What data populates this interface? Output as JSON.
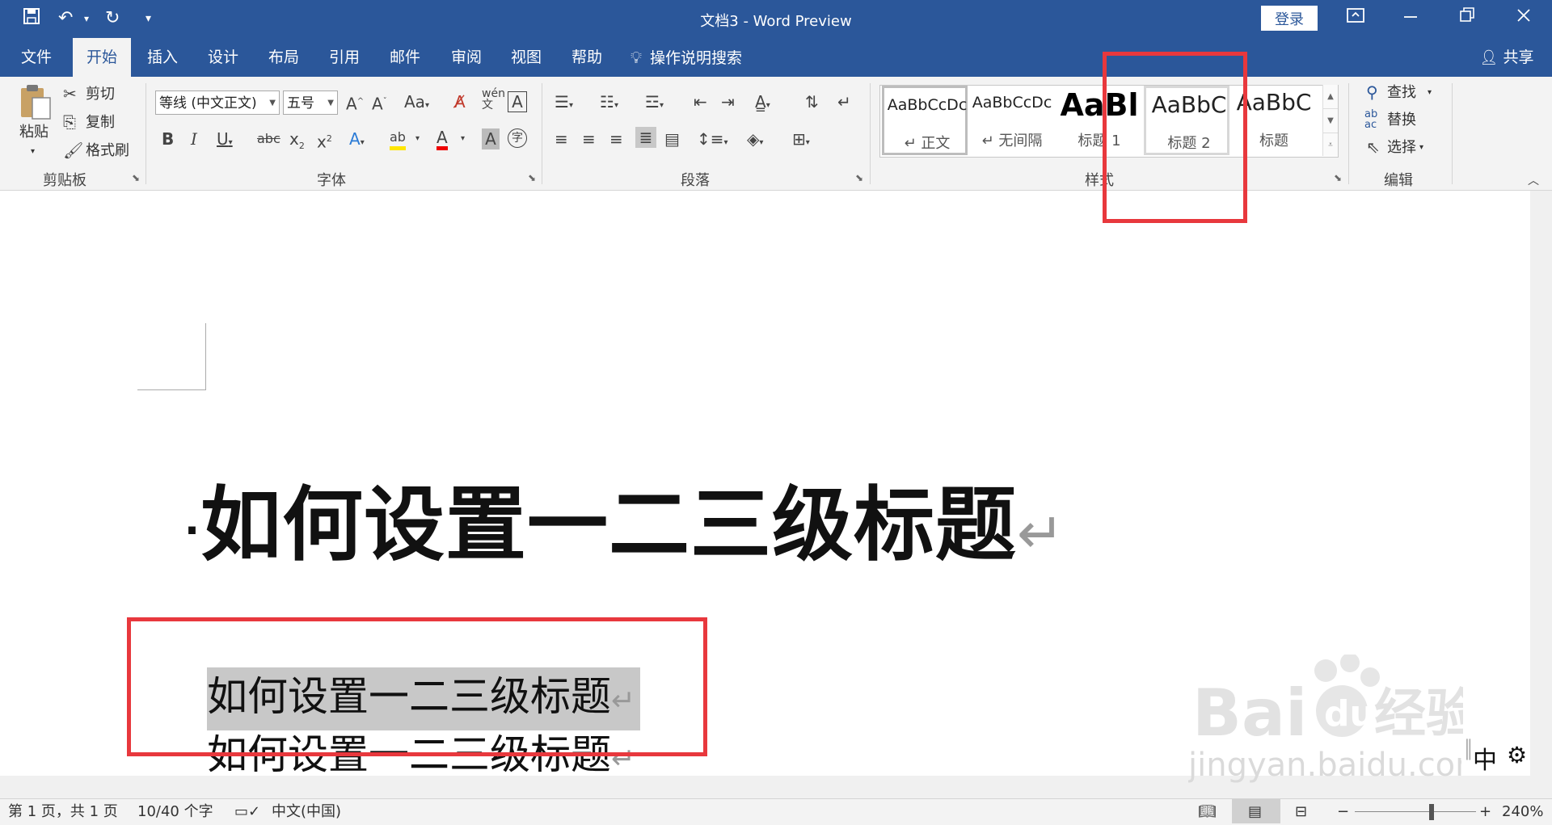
{
  "titlebar": {
    "title": "文档3  -  Word Preview",
    "login": "登录",
    "qat_more": "▾"
  },
  "tabs": [
    "文件",
    "开始",
    "插入",
    "设计",
    "布局",
    "引用",
    "邮件",
    "审阅",
    "视图",
    "帮助"
  ],
  "tell_me": "操作说明搜索",
  "share": "共享",
  "clipboard": {
    "paste": "粘贴",
    "cut": "剪切",
    "copy": "复制",
    "format_painter": "格式刷",
    "label": "剪贴板"
  },
  "font": {
    "family": "等线 (中文正文)",
    "size": "五号",
    "label": "字体"
  },
  "paragraph": {
    "label": "段落"
  },
  "styles": {
    "label": "样式",
    "items": [
      {
        "sample": "AaBbCcDc",
        "name": "↵ 正文"
      },
      {
        "sample": "AaBbCcDc",
        "name": "↵ 无间隔"
      },
      {
        "sample": "AaBl",
        "name": "标题 1"
      },
      {
        "sample": "AaBbC",
        "name": "标题 2"
      },
      {
        "sample": "AaBbC",
        "name": "标题"
      }
    ]
  },
  "editing": {
    "find": "查找",
    "replace": "替换",
    "select": "选择",
    "label": "编辑"
  },
  "document": {
    "heading": "如何设置一二三级标题",
    "line1": "如何设置一二三级标题",
    "line2": "如何设置一二三级标题",
    "para_mark": "↵"
  },
  "statusbar": {
    "page": "第 1 页，共 1 页",
    "words": "10/40 个字",
    "language": "中文(中国)",
    "zoom": "240%"
  },
  "ime": {
    "mode": "中"
  },
  "watermark": {
    "brand": "Bai 经验",
    "url": "jingyan.baidu.com"
  },
  "colors": {
    "word_blue": "#2b579a",
    "annotation_red": "#e8383d"
  }
}
